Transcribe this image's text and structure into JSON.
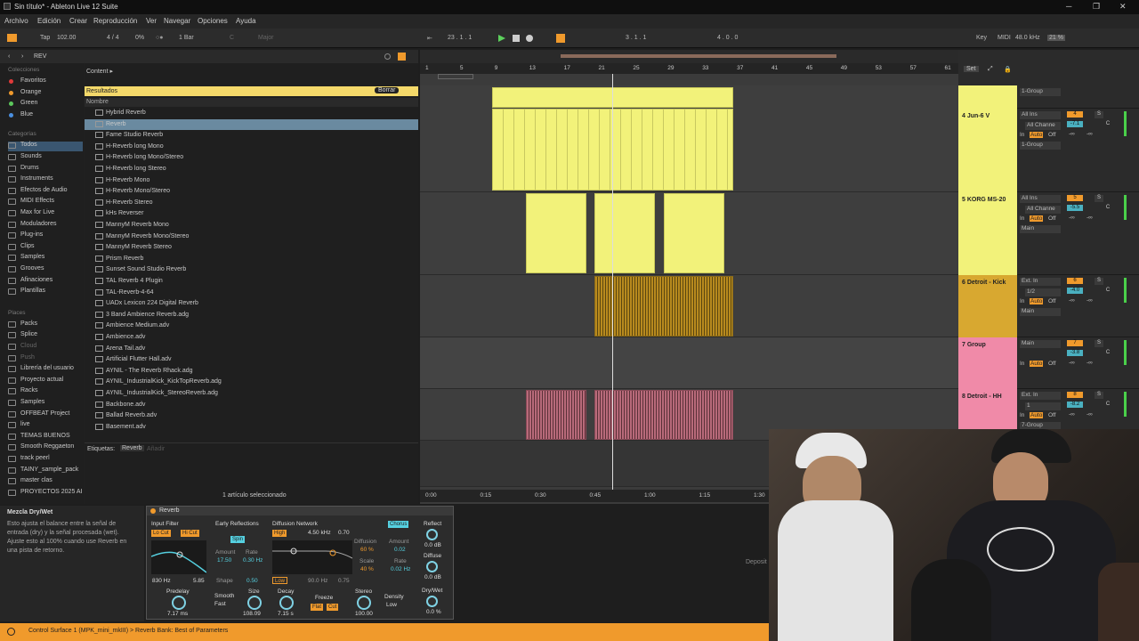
{
  "window": {
    "title": "Sin título* - Ableton Live 12 Suite",
    "minimize": "─",
    "restore": "❐",
    "close": "✕"
  },
  "menu": [
    "Archivo",
    "Edición",
    "Crear",
    "Reproducción",
    "Ver",
    "Navegar",
    "Opciones",
    "Ayuda"
  ],
  "transport": {
    "tap": "Tap",
    "tempo": "102.00",
    "signature": "4 / 4",
    "groove": "0%",
    "quantize": "1 Bar",
    "key": "C",
    "scale": "Major",
    "position": "23 .  1 .  1",
    "loop_start": "3 .  1 .  1",
    "loop_length": "4 .  0 .  0",
    "key_label": "Key",
    "midi_label": "MIDI",
    "sample_rate": "48.0 kHz",
    "cpu": "21 %"
  },
  "browser": {
    "search": "REV",
    "content_label": "Content ▸",
    "collections_header": "Colecciones",
    "collections": [
      {
        "label": "Favoritos",
        "color": "#e03a3a"
      },
      {
        "label": "Orange",
        "color": "#f09a2c"
      },
      {
        "label": "Green",
        "color": "#5cc85c"
      },
      {
        "label": "Blue",
        "color": "#4a8fe0"
      }
    ],
    "categories_header": "Categorías",
    "categories": [
      "Todos",
      "Sounds",
      "Drums",
      "Instruments",
      "Efectos de Audio",
      "MIDI Effects",
      "Max for Live",
      "Moduladores",
      "Plug-ins",
      "Clips",
      "Samples",
      "Grooves",
      "Afinaciones",
      "Plantillas"
    ],
    "places_header": "Places",
    "places": [
      "Packs",
      "Splice",
      "Cloud",
      "Push",
      "Librería del usuario",
      "Proyecto actual",
      "Racks",
      "Samples",
      "OFFBEAT Project",
      "live",
      "TEMAS BUENOS",
      "Smooth Reggaeton",
      "track peerl",
      "TAINY_sample_pack",
      "master clas",
      "PROYECTOS 2025 AI"
    ],
    "results_label": "Resultados",
    "clear_label": "Borrar",
    "column_name": "Nombre",
    "files": [
      "Hybrid Reverb",
      "Reverb",
      "Fame Studio Reverb",
      "H-Reverb long Mono",
      "H-Reverb long Mono/Stereo",
      "H-Reverb long Stereo",
      "H-Reverb Mono",
      "H-Reverb Mono/Stereo",
      "H-Reverb Stereo",
      "kHs Reverser",
      "MannyM Reverb Mono",
      "MannyM Reverb Mono/Stereo",
      "MannyM Reverb Stereo",
      "Prism Reverb",
      "Sunset Sound Studio Reverb",
      "TAL Reverb 4 Plugin",
      "TAL-Reverb-4-64",
      "UADx Lexicon 224 Digital Reverb",
      "3 Band Ambience Reverb.adg",
      "Ambience Medium.adv",
      "Ambience.adv",
      "Arena Tail.adv",
      "Artificial Flutter Hall.adv",
      "AYNIL - The Reverb Rhack.adg",
      "AYNIL_IndustrialKick_KickTopReverb.adg",
      "AYNIL_IndustrialKick_StereoReverb.adg",
      "Backbone.adv",
      "Ballad Reverb.adv",
      "Basement.adv"
    ],
    "tags_label": "Etiquetas:",
    "tag": "Reverb",
    "tag_add": "Añadir",
    "selected_status": "1 artículo seleccionado"
  },
  "ruler": [
    "1",
    "5",
    "9",
    "13",
    "17",
    "21",
    "25",
    "29",
    "33",
    "37",
    "41",
    "45",
    "49",
    "53",
    "57",
    "61"
  ],
  "timeline": [
    "0:00",
    "0:15",
    "0:30",
    "0:45",
    "1:00",
    "1:15",
    "1:30"
  ],
  "set_label": "Set",
  "tracks": [
    {
      "name": "",
      "input": "1-Group",
      "number": "",
      "color": "#f2f27a"
    },
    {
      "name": "4 Jun-6 V",
      "input": "All Ins",
      "channel": "All Channe",
      "group": "1-Group",
      "number": "4",
      "vol": "-7.1",
      "color": "#f2f27a"
    },
    {
      "name": "5 KORG MS-20",
      "input": "All Ins",
      "channel": "All Channe",
      "group": "Main",
      "number": "5",
      "vol": "-5.5",
      "color": "#f2f27a"
    },
    {
      "name": "6 Detroit - Kick",
      "input": "Ext. In",
      "channel": "1/2",
      "group": "Main",
      "number": "6",
      "vol": "-4.0",
      "color": "#d8a830"
    },
    {
      "name": "7 Group",
      "input": "Main",
      "channel": "",
      "group": "",
      "number": "7",
      "vol": "-3.8",
      "color": "#f08aa8"
    },
    {
      "name": "8 Detroit - HH",
      "input": "Ext. In",
      "channel": "1",
      "group": "7-Group",
      "number": "8",
      "vol": "-8.2",
      "color": "#f08aa8"
    }
  ],
  "mixer_labels": {
    "in": "In",
    "auto": "Auto",
    "off": "Off",
    "inf": "-∞",
    "s": "S",
    "c": "C"
  },
  "info": {
    "title": "Mezcla Dry/Wet",
    "text": [
      "Esto ajusta el balance entre la señal de",
      "entrada (dry) y la señal procesada (wet).",
      "Ajuste esto al 100% cuando use Reverb en",
      "una pista de retorno."
    ]
  },
  "device": {
    "name": "Reverb",
    "input_filter": "Input Filter",
    "lo_cut": "Lo Cut",
    "hi_cut": "Hi Cut",
    "freq": "830 Hz",
    "width": "5.85",
    "early": "Early Reflections",
    "spin": "Spin",
    "amount_label": "Amount",
    "amount": "17.50",
    "rate_label": "Rate",
    "rate": "0.30 Hz",
    "shape_label": "Shape",
    "shape": "0.50",
    "diffusion_net": "Diffusion Network",
    "high": "High",
    "high_freq": "4.50 kHz",
    "high_q": "0.70",
    "diffusion_label": "Diffusion",
    "diffusion": "60 %",
    "scale_label": "Scale",
    "scale": "40 %",
    "low": "Low",
    "low_freq": "90.0 Hz",
    "low_q": "0.75",
    "chorus": "Chorus",
    "ch_amount": "0.02",
    "ch_rate": "0.02 Hz",
    "reflect": "Reflect",
    "reflect_val": "0.0 dB",
    "diffuse": "Diffuse",
    "diffuse_val": "0.0 dB",
    "drywet": "Dry/Wet",
    "drywet_val": "0.0 %",
    "predelay": "Predelay",
    "predelay_val": "7.17 ms",
    "smooth": "Smooth",
    "smooth_val": "Fast",
    "size": "Size",
    "size_val": "108.09",
    "decay": "Decay",
    "decay_val": "7.15 s",
    "freeze": "Freeze",
    "flat": "Flat",
    "cut": "Cut",
    "stereo": "Stereo",
    "stereo_val": "100.00",
    "density": "Density",
    "density_val": "Low"
  },
  "drop_hint": "Deposit",
  "status": "Control Surface 1 (MPK_mini_mkIII) > Reverb Bank: Best of Parameters"
}
